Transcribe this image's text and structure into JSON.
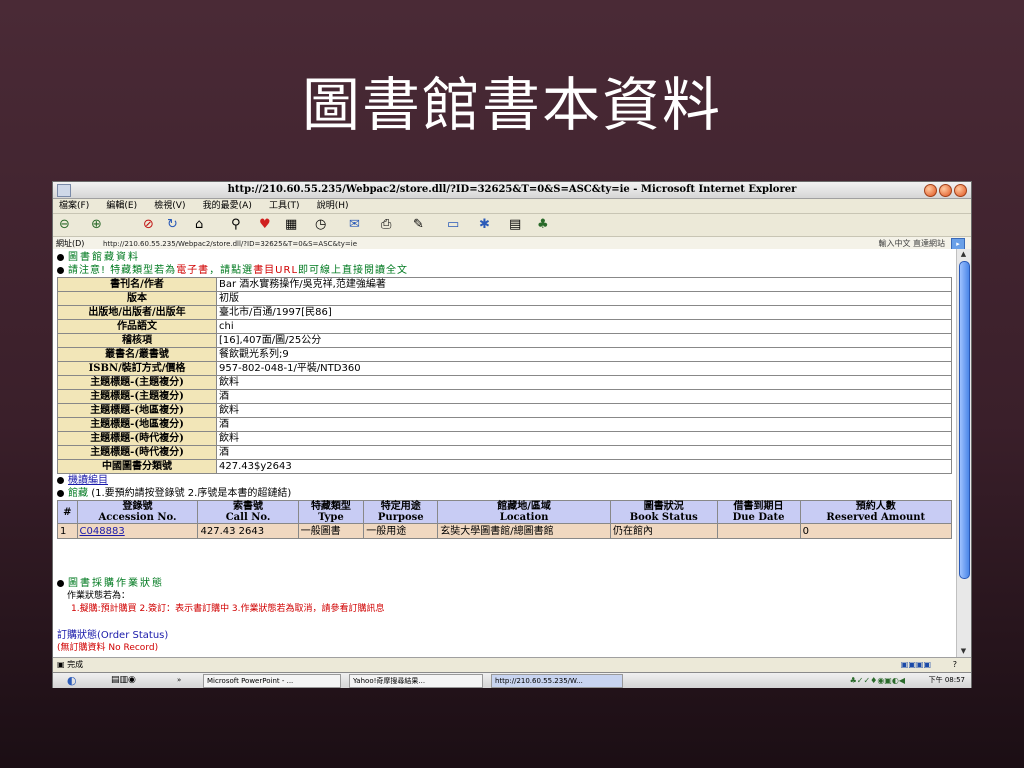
{
  "slide": {
    "title": "圖書館書本資料"
  },
  "window": {
    "title": "http://210.60.55.235/Webpac2/store.dll/?ID=32625&T=0&S=ASC&ty=ie - Microsoft Internet Explorer",
    "menu": [
      "檔案(F)",
      "編輯(E)",
      "檢視(V)",
      "我的最愛(A)",
      "工具(T)",
      "說明(H)"
    ],
    "address_label": "網址(D)",
    "url": "http://210.60.55.235/Webpac2/store.dll/?ID=32625&T=0&S=ASC&ty=ie",
    "ime": "輸入中文 直達網站"
  },
  "page": {
    "heading": "圖書館藏資料",
    "notice_prefix": "請注意! 特藏類型若為",
    "notice_ebook": "電子書",
    "notice_mid": "，請點選",
    "notice_url": "書目URL",
    "notice_suffix": "即可線上直接閱讀全文",
    "record": [
      {
        "label": "書刊名/作者",
        "value": "Bar 酒水實務操作/吳克祥,范建強編著"
      },
      {
        "label": "版本",
        "value": "初版"
      },
      {
        "label": "出版地/出版者/出版年",
        "value": "臺北市/百通/1997[民86]"
      },
      {
        "label": "作品語文",
        "value": "chi"
      },
      {
        "label": "稽核項",
        "value": "[16],407面/圖/25公分"
      },
      {
        "label": "叢書名/叢書號",
        "value": "餐飲觀光系列;9"
      },
      {
        "label": "ISBN/裝訂方式/價格",
        "value": "957-802-048-1/平裝/NTD360"
      },
      {
        "label": "主題標題-(主題複分)",
        "value": "飲料"
      },
      {
        "label": "主題標題-(主題複分)",
        "value": "酒"
      },
      {
        "label": "主題標題-(地區複分)",
        "value": "飲料"
      },
      {
        "label": "主題標題-(地區複分)",
        "value": "酒"
      },
      {
        "label": "主題標題-(時代複分)",
        "value": "飲料"
      },
      {
        "label": "主題標題-(時代複分)",
        "value": "酒"
      },
      {
        "label": "中國圖書分類號",
        "value": "427.43$y2643"
      }
    ],
    "machine_catalog": "機讀編目",
    "holdings_title": "館藏",
    "holdings_note": "(1.要預約請按登錄號 2.序號是本書的超鏈結)",
    "holdings_headers": [
      {
        "zh": "#",
        "en": ""
      },
      {
        "zh": "登錄號",
        "en": "Accession No."
      },
      {
        "zh": "索書號",
        "en": "Call No."
      },
      {
        "zh": "特藏類型",
        "en": "Type"
      },
      {
        "zh": "特定用途",
        "en": "Purpose"
      },
      {
        "zh": "館藏地/區域",
        "en": "Location"
      },
      {
        "zh": "圖書狀況",
        "en": "Book Status"
      },
      {
        "zh": "借書到期日",
        "en": "Due Date"
      },
      {
        "zh": "預約人數",
        "en": "Reserved Amount"
      }
    ],
    "holdings_row": {
      "num": "1",
      "accession": "C048883",
      "call_no": "427.43 2643",
      "type": "一般圖書",
      "purpose": "一般用途",
      "location": "玄奘大學圖書館/總圖書館",
      "status": "仍在館內",
      "due": "",
      "reserved": "0"
    },
    "purchase_title": "圖書採購作業狀態",
    "purchase_intro": "作業狀態若為：",
    "purchase_desc": "1.擬購:預計購買  2.簽訂：表示書訂購中  3.作業狀態若為取消，請參看訂購訊息",
    "order_status": "訂購狀態(Order Status)",
    "no_record": "(無訂購資料 No Record)"
  },
  "status": {
    "text": "完成"
  },
  "taskbar": {
    "tasks": [
      "Microsoft PowerPoint - ...",
      "Yahoo!奇摩搜尋結果...",
      "http://210.60.55.235/W..."
    ],
    "clock": "下午 08:57"
  }
}
